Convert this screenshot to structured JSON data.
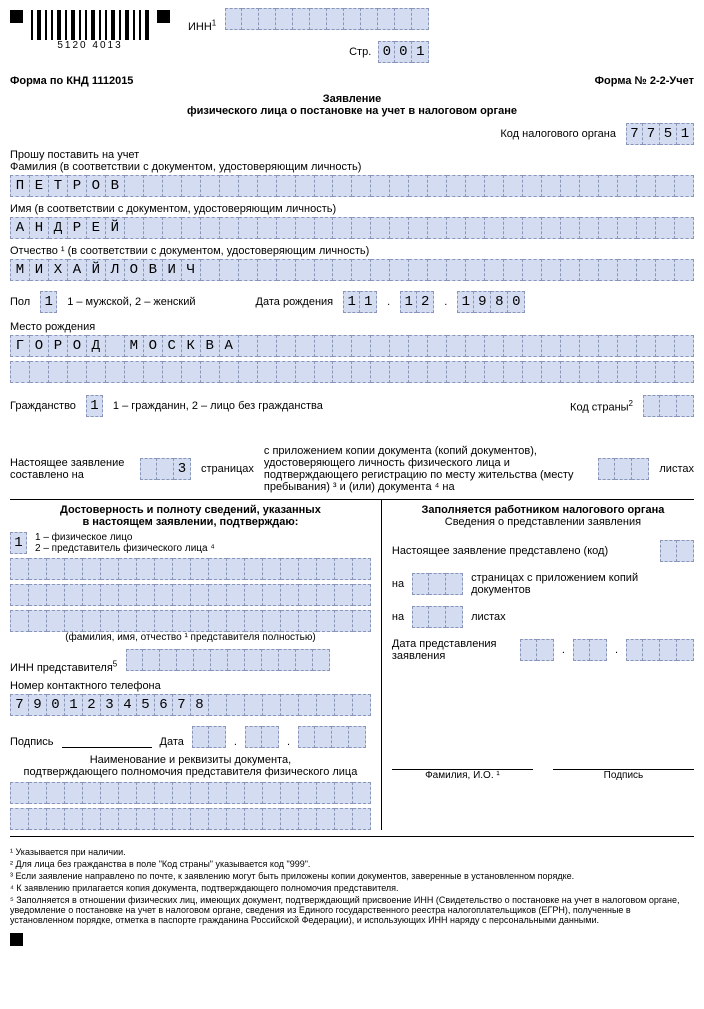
{
  "header": {
    "barcode_number": "5120 4013",
    "inn_label": "ИНН",
    "page_label": "Стр.",
    "page_value": "001",
    "form_knd": "Форма по КНД 1112015",
    "form_number": "Форма № 2-2-Учет",
    "title_l1": "Заявление",
    "title_l2": "физического лица о постановке на учет в налоговом органе",
    "tax_org_label": "Код налогового органа",
    "tax_org_code": "7751"
  },
  "fields": {
    "request_line": "Прошу поставить на учет",
    "surname_label": "Фамилия (в соответствии с документом, удостоверяющим личность)",
    "surname": "ПЕТРОВ",
    "name_label": "Имя (в соответствии с документом, удостоверяющим личность)",
    "name": "АНДРЕЙ",
    "patronymic_label": "Отчество ¹ (в соответствии с документом, удостоверяющим личность)",
    "patronymic": "МИХАЙЛОВИЧ",
    "sex_label": "Пол",
    "sex_value": "1",
    "sex_legend": "1 – мужской, 2 – женский",
    "dob_label": "Дата рождения",
    "dob_day": "11",
    "dob_month": "12",
    "dob_year": "1980",
    "birthplace_label": "Место рождения",
    "birthplace": "ГОРОД МОСКВА",
    "citizenship_label": "Гражданство",
    "citizenship_value": "1",
    "citizenship_legend": "1 – гражданин, 2 – лицо без гражданства",
    "country_label": "Код страны",
    "country_sup": "2"
  },
  "pages_block": {
    "prefix": "Настоящее заявление составлено на",
    "pages_value": "3",
    "pages_unit": "страницах",
    "attach_text": "с приложением копии документа (копий документов), удостоверяющего личность физического лица и подтверждающего регистрацию по месту жительства (месту пребывания) ³ и (или) документа ⁴ на",
    "sheets_unit": "листах"
  },
  "left_col": {
    "title1": "Достоверность и полноту сведений, указанных",
    "title2": "в настоящем заявлении, подтверждаю:",
    "submitter_value": "1",
    "legend1": "1 – физическое лицо",
    "legend2": "2 – представитель физического лица ⁴",
    "fio_hint": "(фамилия, имя, отчество ¹ представителя полностью)",
    "inn_rep_label": "ИНН представителя",
    "inn_rep_sup": "5",
    "phone_label": "Номер контактного телефона",
    "phone": "79012345678",
    "sign_label": "Подпись",
    "date_label": "Дата",
    "doc_title": "Наименование и реквизиты документа,",
    "doc_title2": "подтверждающего полномочия представителя физического лица"
  },
  "right_col": {
    "title": "Заполняется работником налогового органа",
    "sub": "Сведения о представлении заявления",
    "presented": "Настоящее заявление представлено (код)",
    "on1": "на",
    "pages_attach": "страницах с приложением копий документов",
    "on2": "на",
    "sheets": "листах",
    "date_label": "Дата представления заявления",
    "fio_label": "Фамилия, И.О. ¹",
    "sign_label": "Подпись"
  },
  "footnotes": {
    "f1": "¹  Указывается при наличии.",
    "f2": "²  Для лица без гражданства в поле \"Код страны\" указывается код \"999\".",
    "f3": "³  Если заявление направлено по почте, к заявлению могут быть приложены копии документов, заверенные в установленном порядке.",
    "f4": "⁴  К заявлению прилагается копия документа, подтверждающего полномочия представителя.",
    "f5": "⁵  Заполняется в отношении физических лиц, имеющих документ, подтверждающий присвоение ИНН (Свидетельство о постановке на учет в налоговом органе, уведомление о постановке на учет в налоговом органе, сведения из Единого государственного реестра налогоплательщиков (ЕГРН), полученные в установленном порядке, отметка в паспорте гражданина Российской Федерации), и использующих ИНН наряду с персональными данными."
  }
}
